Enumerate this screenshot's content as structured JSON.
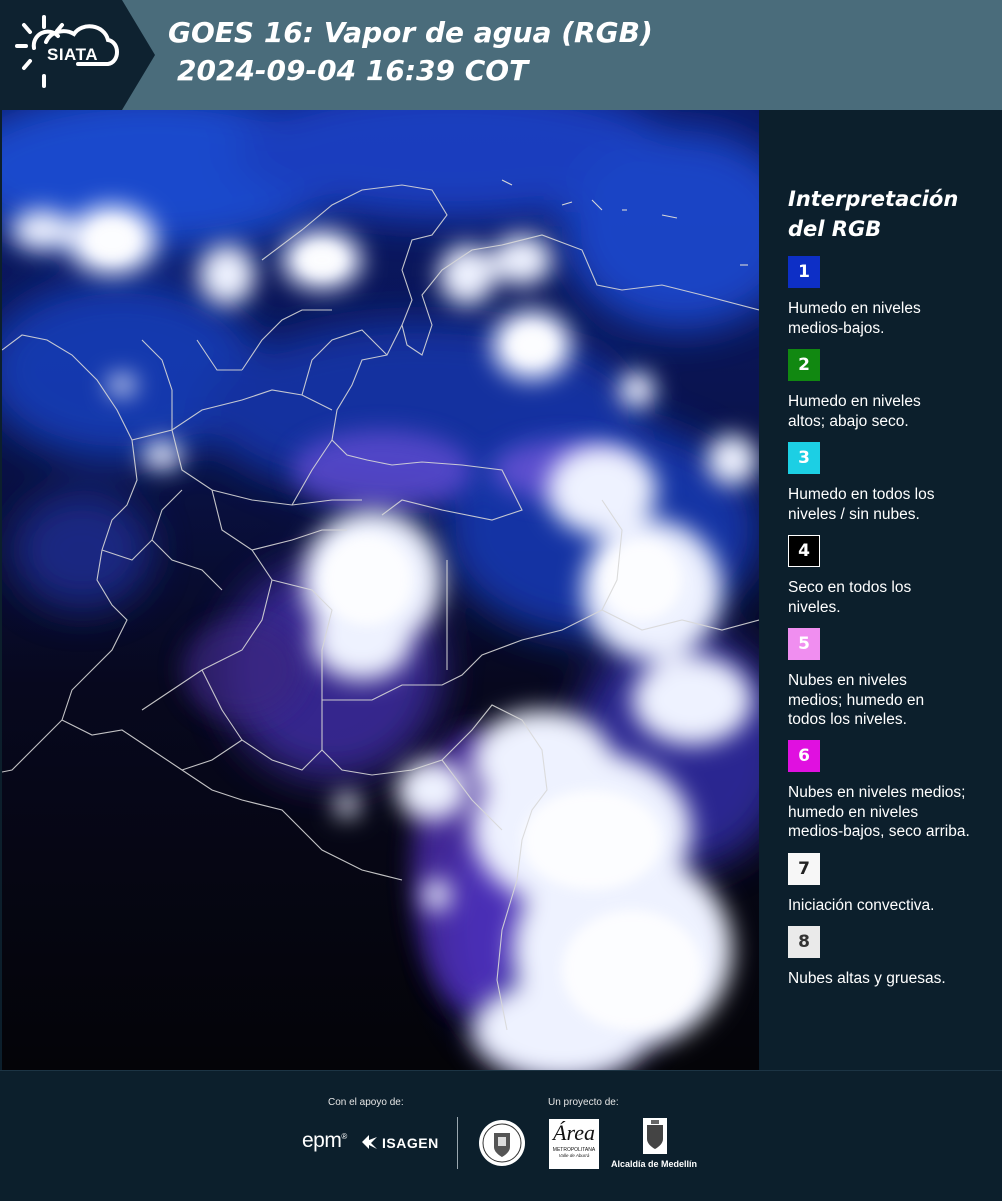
{
  "header": {
    "logo_text": "SIATA",
    "title_line1": "GOES 16: Vapor de agua (RGB)",
    "title_line2": "2024-09-04 16:39 COT",
    "background_color": "#4a6c7b"
  },
  "map": {
    "description_icon": "satellite-water-vapor-rgb-map",
    "cloud_color": "#eef2ff",
    "moist_color": "#1e4fe0",
    "dry_color": "#05050c"
  },
  "legend": {
    "title_line1": "Interpretación",
    "title_line2": "del RGB",
    "items": [
      {
        "number": "1",
        "color": "#0d2fc6",
        "line1": "Humedo en niveles",
        "line2": "medios-bajos.",
        "line3": ""
      },
      {
        "number": "2",
        "color": "#118811",
        "line1": "Humedo en niveles",
        "line2": "altos; abajo seco.",
        "line3": ""
      },
      {
        "number": "3",
        "color": "#1ccfe4",
        "line1": "Humedo en todos los",
        "line2": "niveles / sin nubes.",
        "line3": ""
      },
      {
        "number": "4",
        "color": "#000000",
        "line1": "Seco en todos los",
        "line2": "niveles.",
        "line3": ""
      },
      {
        "number": "5",
        "color": "#f08ef0",
        "line1": "Nubes en niveles",
        "line2": "medios; humedo en",
        "line3": "todos los niveles."
      },
      {
        "number": "6",
        "color": "#e010e0",
        "line1": "Nubes en niveles medios;",
        "line2": "humedo en niveles",
        "line3": "medios-bajos, seco arriba."
      },
      {
        "number": "7",
        "color": "#f7f7f7",
        "line1": "Iniciación convectiva.",
        "line2": "",
        "line3": ""
      },
      {
        "number": "8",
        "color": "#eaeaea",
        "line1": "Nubes altas y gruesas.",
        "line2": "",
        "line3": ""
      }
    ]
  },
  "footer": {
    "support_label": "Con el apoyo de:",
    "project_label": "Un proyecto de:",
    "epm": "epm",
    "isagen": "ISAGEN",
    "area_name": "Área",
    "area_sub1": "METROPOLITANA",
    "area_sub2": "Valle de Aburrá",
    "alcaldia": "Alcaldía de Medellín"
  }
}
